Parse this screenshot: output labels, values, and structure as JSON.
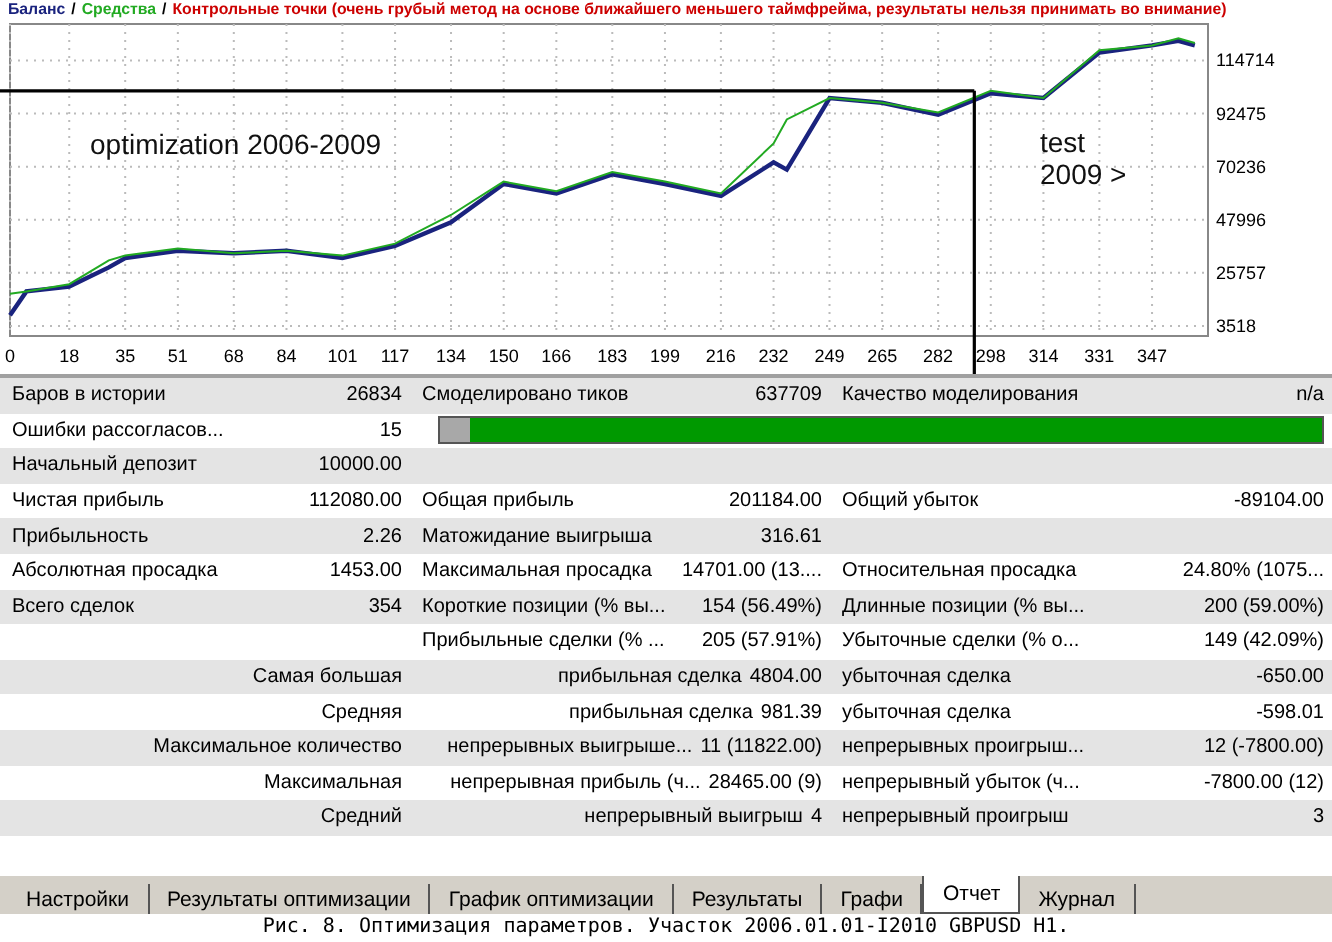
{
  "chart": {
    "legend_note": {
      "text": "Контрольные точки (очень грубый метод на основе ближайшего меньшего таймфрейма, результаты нельзя принимать во внимание)",
      "color": "#cc0000"
    },
    "legend_separator": "/",
    "chart_data": {
      "type": "line",
      "x": [
        0,
        5,
        18,
        30,
        35,
        51,
        68,
        84,
        101,
        117,
        134,
        150,
        166,
        183,
        199,
        216,
        232,
        236,
        249,
        265,
        282,
        298,
        314,
        331,
        347,
        355,
        360
      ],
      "series": [
        {
          "name": "Баланс",
          "color": "#1a237e",
          "values": [
            8000,
            18000,
            20000,
            28000,
            32000,
            35000,
            34000,
            35000,
            32000,
            37000,
            47000,
            63000,
            59000,
            67000,
            63000,
            58000,
            72000,
            69000,
            99000,
            97000,
            92000,
            101000,
            99000,
            118000,
            121000,
            123000,
            121000
          ]
        },
        {
          "name": "Средства",
          "color": "#22aa22",
          "values": [
            17000,
            18000,
            21000,
            31000,
            33000,
            36000,
            34000,
            35000,
            33000,
            38000,
            50000,
            64000,
            60000,
            68000,
            64000,
            59000,
            80000,
            90000,
            99000,
            97000,
            93000,
            102000,
            99000,
            119000,
            121000,
            124000,
            122000
          ]
        }
      ],
      "xlim": [
        0,
        364
      ],
      "ylim": [
        -700,
        130000
      ],
      "grid": true,
      "ref_lines": [
        {
          "axis": "y",
          "value": 102000
        },
        {
          "axis": "x",
          "value": 293
        }
      ],
      "xticks": [
        0,
        18,
        35,
        51,
        68,
        84,
        101,
        117,
        134,
        150,
        166,
        183,
        199,
        216,
        232,
        249,
        265,
        282,
        298,
        314,
        331,
        347
      ],
      "yticks": [
        3518,
        25757,
        47996,
        70236,
        92475,
        114714
      ],
      "annotations": [
        "optimization 2006-2009",
        "test 2009 >"
      ]
    }
  },
  "report": {
    "rows": [
      {
        "kind": "summary",
        "column_1": "Баров в истории",
        "column_2": "26834",
        "column_3": "Смоделировано тиков",
        "column_4": "637709",
        "column_5": "Качество моделирования",
        "column_6": "n/a"
      },
      {
        "kind": "summary",
        "column_1": "Ошибки рассогласов...",
        "column_2": "15",
        "bar": [
          {
            "color": "#a8a8a8",
            "level": 0.035
          },
          {
            "color": "#009900",
            "level": 0.965
          }
        ]
      },
      {
        "kind": "summary",
        "column_1": "Начальный депозит",
        "column_2": "10000.00"
      },
      {
        "kind": "summary",
        "column_1": "Чистая прибыль",
        "column_2": "112080.00",
        "column_3": "Общая прибыль",
        "column_4": "201184.00",
        "column_5": "Общий убыток",
        "column_6": "-89104.00"
      },
      {
        "kind": "summary",
        "column_1": "Прибыльность",
        "column_2": "2.26",
        "column_3": "Матожидание выигрыша",
        "column_4": "316.61"
      },
      {
        "kind": "summary",
        "column_1": "Абсолютная просадка",
        "column_2": "1453.00",
        "column_3": "Максимальная просадка",
        "column_4": "14701.00 (13....",
        "column_5": "Относительная просадка",
        "column_6": "24.80% (1075..."
      },
      {
        "kind": "summary",
        "column_1": "Всего сделок",
        "column_2": "354",
        "column_3": "Короткие позиции (% вы...",
        "column_4": "154 (56.49%)",
        "column_5": "Длинные позиции (% вы...",
        "column_6": "200 (59.00%)"
      },
      {
        "kind": "summary",
        "column_3": "Прибыльные сделки (% ...",
        "column_4": "205 (57.91%)",
        "column_5": "Убыточные сделки (% о...",
        "column_6": "149 (42.09%)"
      },
      {
        "kind": "detail",
        "column_1": "Самая большая",
        "column_3": "прибыльная сделка",
        "column_4": "4804.00",
        "column_5": "убыточная сделка",
        "column_6": "-650.00"
      },
      {
        "kind": "detail",
        "column_1": "Средняя",
        "column_3": "прибыльная сделка",
        "column_4": "981.39",
        "column_5": "убыточная сделка",
        "column_6": "-598.01"
      },
      {
        "kind": "detail",
        "column_1": "Максимальное количество",
        "column_3": "непрерывных выигрыше...",
        "column_4": "11 (11822.00)",
        "column_5": "непрерывных проигрыш...",
        "column_6": "12 (-7800.00)"
      },
      {
        "kind": "detail",
        "column_1": "Максимальная",
        "column_3": "непрерывная прибыль (ч...",
        "column_4": "28465.00 (9)",
        "column_5": "непрерывный убыток (ч...",
        "column_6": "-7800.00 (12)"
      },
      {
        "kind": "detail",
        "column_1": "Средний",
        "column_3": "непрерывный выигрыш",
        "column_4": "4",
        "column_5": "непрерывный проигрыш",
        "column_6": "3"
      }
    ]
  },
  "tabs": [
    {
      "label": "Настройки",
      "selected": false
    },
    {
      "label": "Результаты оптимизации",
      "selected": false
    },
    {
      "label": "График оптимизации",
      "selected": false
    },
    {
      "label": "Результаты",
      "selected": false
    },
    {
      "label": "Графи",
      "selected": false
    },
    {
      "label": "Отчет",
      "selected": true
    },
    {
      "label": "Журнал",
      "selected": false
    }
  ],
  "caption": "Рис. 8. Оптимизация параметров. Участок 2006.01.01-I2010 GBPUSD H1."
}
